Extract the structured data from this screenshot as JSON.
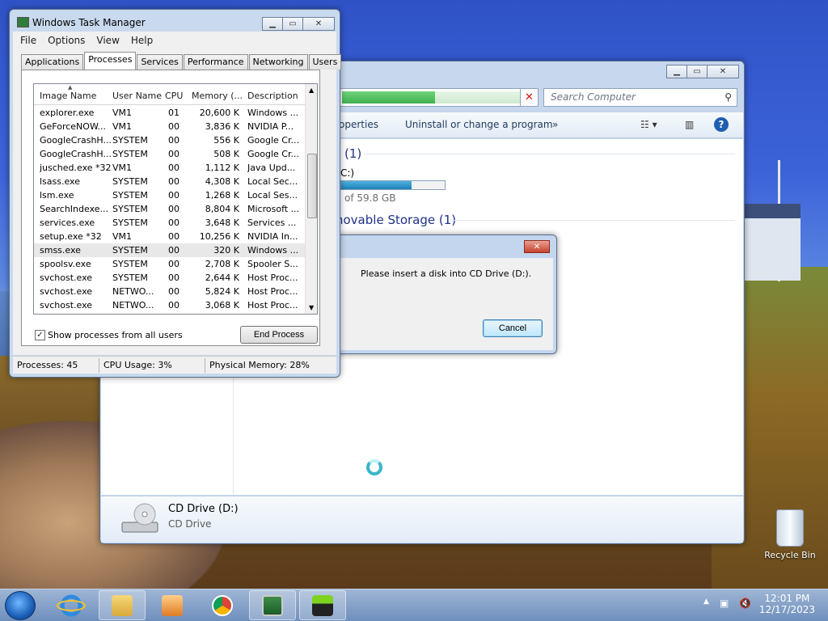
{
  "explorer": {
    "search_placeholder": "Search Computer",
    "commands": [
      "operties",
      "Uninstall or change a program",
      "»"
    ],
    "hard_disk_group": "(1)",
    "drive_label_fragment": "C:)",
    "drive_used_fraction": 0.68,
    "drive_free": "of 59.8 GB",
    "removable_group": "novable Storage (1)",
    "details_name": "CD Drive (D:)",
    "details_type": "CD Drive",
    "address_progress": 0.5
  },
  "taskman": {
    "title": "Windows Task Manager",
    "menu": [
      "File",
      "Options",
      "View",
      "Help"
    ],
    "tabs": [
      "Applications",
      "Processes",
      "Services",
      "Performance",
      "Networking",
      "Users"
    ],
    "active_tab": "Processes",
    "columns": [
      "Image Name",
      "User Name",
      "CPU",
      "Memory (...",
      "Description"
    ],
    "rows": [
      [
        "explorer.exe",
        "VM1",
        "01",
        "20,600 K",
        "Windows ..."
      ],
      [
        "GeForceNOW...",
        "VM1",
        "00",
        "3,836 K",
        "NVIDIA P..."
      ],
      [
        "GoogleCrashH...",
        "SYSTEM",
        "00",
        "556 K",
        "Google Cr..."
      ],
      [
        "GoogleCrashH...",
        "SYSTEM",
        "00",
        "508 K",
        "Google Cr..."
      ],
      [
        "jusched.exe *32",
        "VM1",
        "00",
        "1,112 K",
        "Java Upd..."
      ],
      [
        "lsass.exe",
        "SYSTEM",
        "00",
        "4,308 K",
        "Local Sec..."
      ],
      [
        "lsm.exe",
        "SYSTEM",
        "00",
        "1,268 K",
        "Local Ses..."
      ],
      [
        "SearchIndexe...",
        "SYSTEM",
        "00",
        "8,804 K",
        "Microsoft ..."
      ],
      [
        "services.exe",
        "SYSTEM",
        "00",
        "3,648 K",
        "Services ..."
      ],
      [
        "setup.exe *32",
        "VM1",
        "00",
        "10,256 K",
        "NVIDIA In..."
      ],
      [
        "smss.exe",
        "SYSTEM",
        "00",
        "320 K",
        "Windows ..."
      ],
      [
        "spoolsv.exe",
        "SYSTEM",
        "00",
        "2,708 K",
        "Spooler S..."
      ],
      [
        "svchost.exe",
        "SYSTEM",
        "00",
        "2,644 K",
        "Host Proc..."
      ],
      [
        "svchost.exe",
        "NETWO...",
        "00",
        "5,824 K",
        "Host Proc..."
      ],
      [
        "svchost.exe",
        "NETWO...",
        "00",
        "3,068 K",
        "Host Proc..."
      ]
    ],
    "selected_row": 10,
    "show_all_label": "Show processes from all users",
    "show_all_checked": true,
    "end_process_label": "End Process",
    "status_processes": "Processes: 45",
    "status_cpu": "CPU Usage: 3%",
    "status_memory": "Physical Memory: 28%"
  },
  "dialog": {
    "message": "Please insert a disk into CD Drive (D:).",
    "cancel_label": "Cancel"
  },
  "desktop": {
    "recycle_bin_label": "Recycle Bin"
  },
  "taskbar": {
    "time": "12:01 PM",
    "date": "12/17/2023"
  }
}
